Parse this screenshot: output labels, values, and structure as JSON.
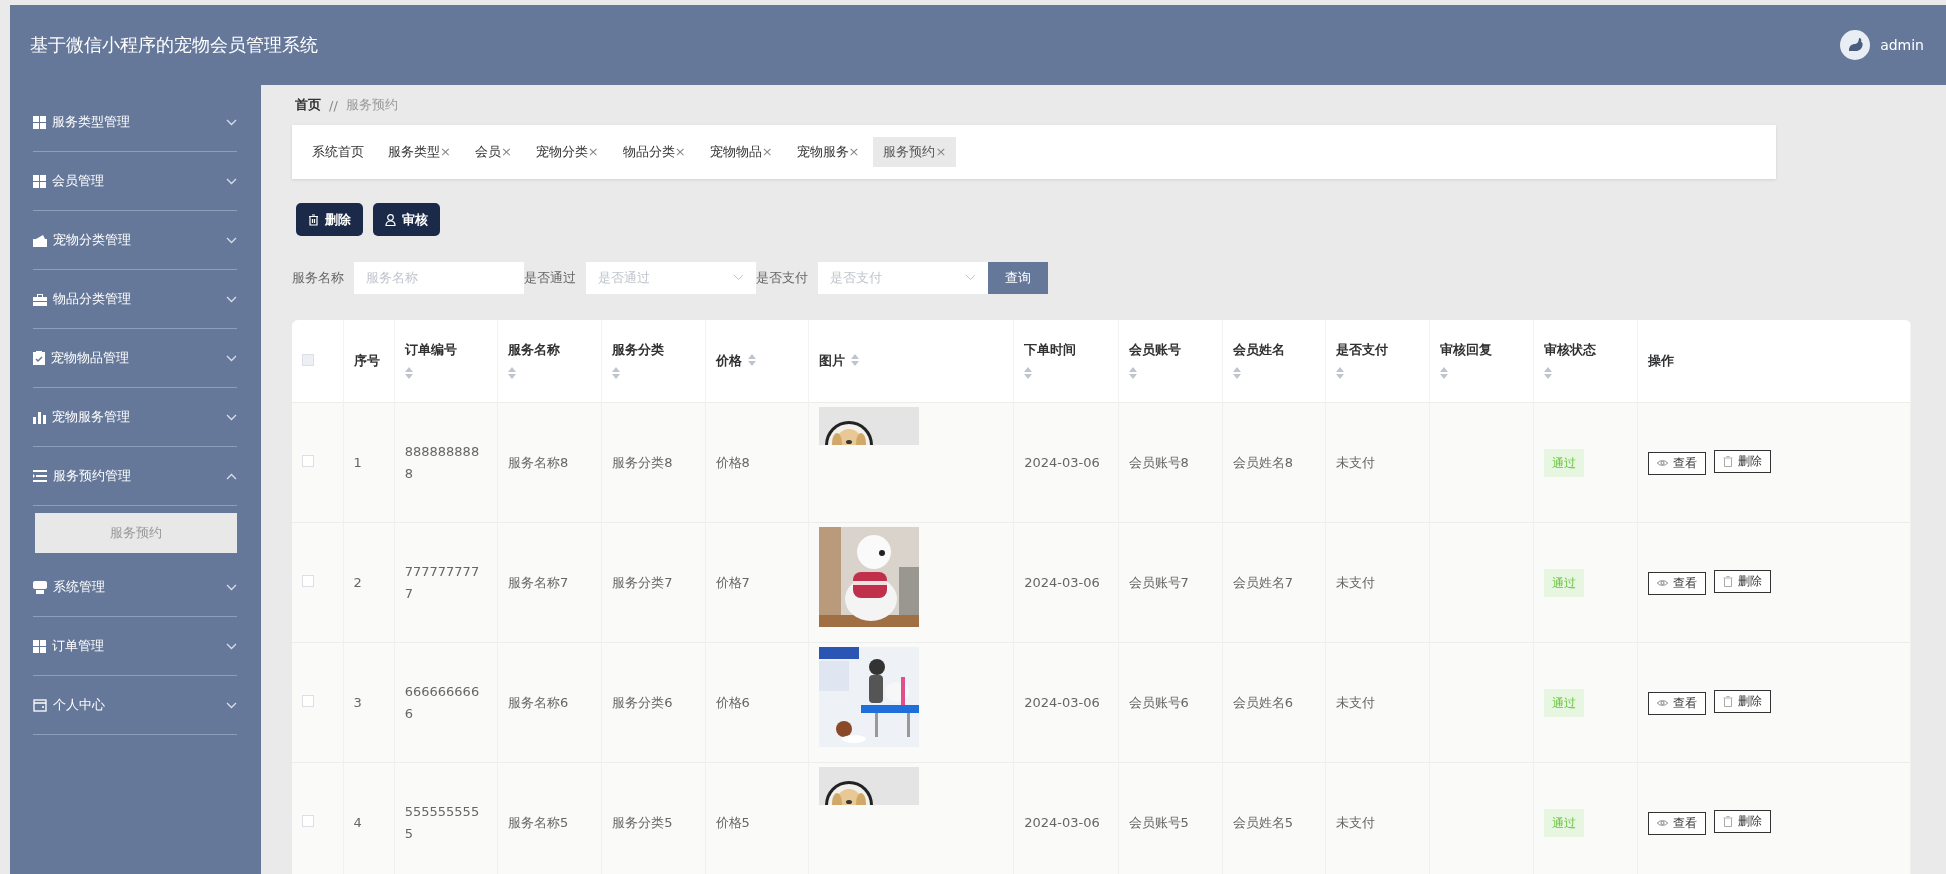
{
  "header": {
    "title": "基于微信小程序的宠物会员管理系统",
    "user": "admin"
  },
  "sidebar": {
    "items": [
      {
        "label": "服务类型管理",
        "expanded": false
      },
      {
        "label": "会员管理",
        "expanded": false
      },
      {
        "label": "宠物分类管理",
        "expanded": false
      },
      {
        "label": "物品分类管理",
        "expanded": false
      },
      {
        "label": "宠物物品管理",
        "expanded": false
      },
      {
        "label": "宠物服务管理",
        "expanded": false
      },
      {
        "label": "服务预约管理",
        "expanded": true,
        "children": [
          {
            "label": "服务预约",
            "selected": true
          }
        ]
      },
      {
        "label": "系统管理",
        "expanded": false
      },
      {
        "label": "订单管理",
        "expanded": false
      },
      {
        "label": "个人中心",
        "expanded": false
      }
    ]
  },
  "breadcrumb": {
    "items": [
      "首页",
      "服务预约"
    ],
    "separator": "//"
  },
  "tabs": [
    {
      "label": "系统首页",
      "selected": false
    },
    {
      "label": "服务类型",
      "close": "×",
      "selected": false
    },
    {
      "label": "会员",
      "close": "×",
      "selected": false
    },
    {
      "label": "宠物分类",
      "close": "×",
      "selected": false
    },
    {
      "label": "物品分类",
      "close": "×",
      "selected": false
    },
    {
      "label": "宠物物品",
      "close": "×",
      "selected": false
    },
    {
      "label": "宠物服务",
      "close": "×",
      "selected": false
    },
    {
      "label": "服务预约",
      "close": "×",
      "selected": true
    }
  ],
  "toolbar": [
    {
      "label": "删除"
    },
    {
      "label": "审核"
    }
  ],
  "filters": [
    {
      "label": "服务名称",
      "kind": "input",
      "placeholder": "服务名称"
    },
    {
      "label": "是否通过",
      "kind": "select",
      "placeholder": "是否通过"
    },
    {
      "label": "是否支付",
      "kind": "select",
      "placeholder": "是否支付"
    }
  ],
  "search_button": "查询",
  "table": {
    "select_all": {
      "checked": false
    },
    "columns": [
      {
        "label": "序号",
        "sortable": false
      },
      {
        "label": "订单编号",
        "sortable": true
      },
      {
        "label": "服务名称",
        "sortable": true
      },
      {
        "label": "服务分类",
        "sortable": true
      },
      {
        "label": "价格",
        "sortable": true
      },
      {
        "label": "图片",
        "sortable": true
      },
      {
        "label": "下单时间",
        "sortable": true
      },
      {
        "label": "会员账号",
        "sortable": true
      },
      {
        "label": "会员姓名",
        "sortable": true
      },
      {
        "label": "是否支付",
        "sortable": true
      },
      {
        "label": "审核回复",
        "sortable": true
      },
      {
        "label": "审核状态",
        "sortable": true
      },
      {
        "label": "操作",
        "sortable": false
      }
    ],
    "rows": [
      {
        "checked": false,
        "cells": [
          "1",
          "8888888888",
          "服务名称8",
          "服务分类8",
          "价格8",
          {
            "kind": "picture"
          },
          "2024-03-06",
          "会员账号8",
          "会员姓名8",
          "未支付",
          ""
        ],
        "status": "通过",
        "actions": [
          "查看",
          "删除"
        ]
      },
      {
        "checked": false,
        "cells": [
          "2",
          "7777777777",
          "服务名称7",
          "服务分类7",
          "价格7",
          {
            "kind": "picture"
          },
          "2024-03-06",
          "会员账号7",
          "会员姓名7",
          "未支付",
          ""
        ],
        "status": "通过",
        "actions": [
          "查看",
          "删除"
        ]
      },
      {
        "checked": false,
        "cells": [
          "3",
          "6666666666",
          "服务名称6",
          "服务分类6",
          "价格6",
          {
            "kind": "picture"
          },
          "2024-03-06",
          "会员账号6",
          "会员姓名6",
          "未支付",
          ""
        ],
        "status": "通过",
        "actions": [
          "查看",
          "删除"
        ]
      },
      {
        "checked": false,
        "cells": [
          "4",
          "5555555555",
          "服务名称5",
          "服务分类5",
          "价格5",
          {
            "kind": "picture"
          },
          "2024-03-06",
          "会员账号5",
          "会员姓名5",
          "未支付",
          ""
        ],
        "status": "通过",
        "actions": [
          "查看",
          "删除"
        ]
      }
    ]
  }
}
